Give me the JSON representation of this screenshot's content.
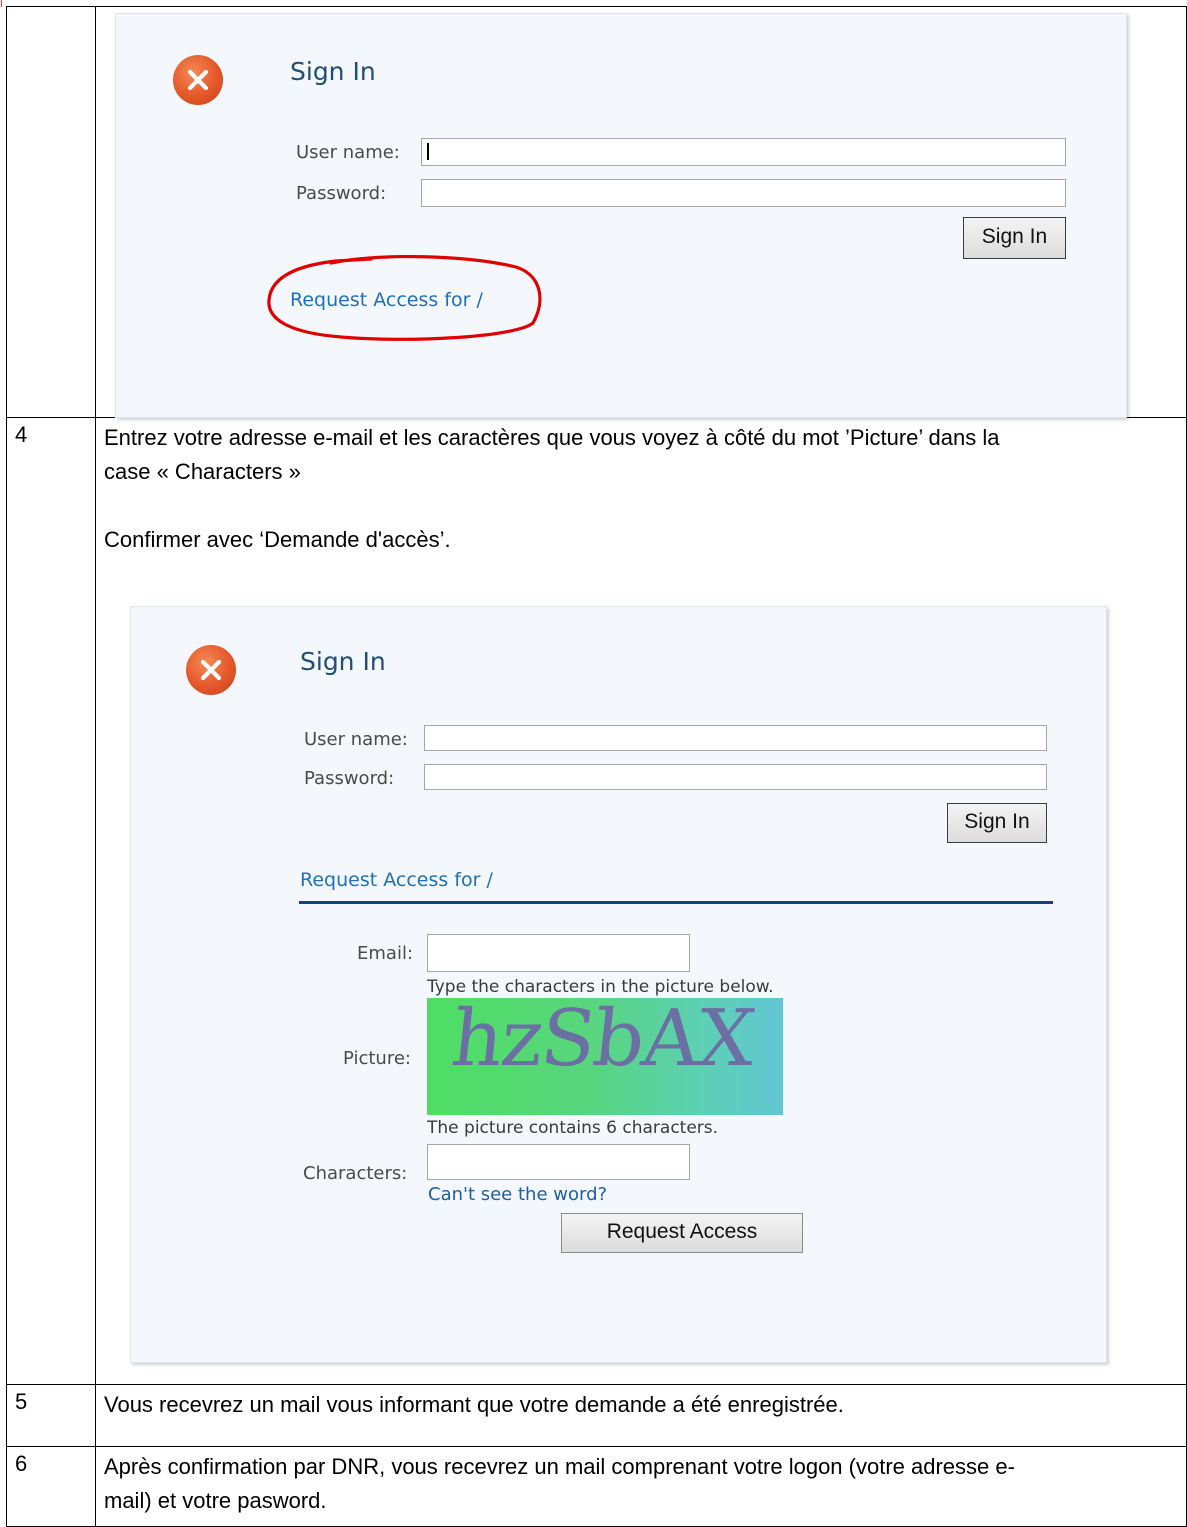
{
  "page": {
    "colors": {
      "icon": "#e4572a",
      "title": "#1f4e78",
      "link": "#1e6fbe",
      "rule": "#1c3d8c",
      "annotation": "#e00000"
    }
  },
  "panel1": {
    "title": "Sign In",
    "username_label": "User name:",
    "password_label": "Password:",
    "signin_button": "Sign In",
    "request_link": "Request Access for /",
    "icon": "error-x-icon"
  },
  "steps": [
    {
      "num": "4",
      "line1": "Entrez votre adresse e-mail et les caractères que vous voyez à côté du mot ’Picture’ dans la",
      "line2": "case « Characters »",
      "line3": "Confirmer avec ‘Demande d'accès’."
    },
    {
      "num": "5",
      "text": "Vous recevrez un mail vous informant que votre demande a été enregistrée."
    },
    {
      "num": "6",
      "line1": "Après confirmation par DNR, vous recevrez un mail comprenant votre logon (votre adresse e-",
      "line2": "mail) et votre pasword."
    }
  ],
  "panel2": {
    "title": "Sign In",
    "username_label": "User name:",
    "password_label": "Password:",
    "signin_button": "Sign In",
    "request_heading": "Request Access for /",
    "email_label": "Email:",
    "captcha_hint": "Type the characters in the picture below.",
    "picture_label": "Picture:",
    "captcha_text": "hzSbAX",
    "captcha_count": "The picture contains 6 characters.",
    "characters_label": "Characters:",
    "cant_see_link": "Can't see the word?",
    "request_button": "Request Access",
    "icon": "error-x-icon"
  }
}
